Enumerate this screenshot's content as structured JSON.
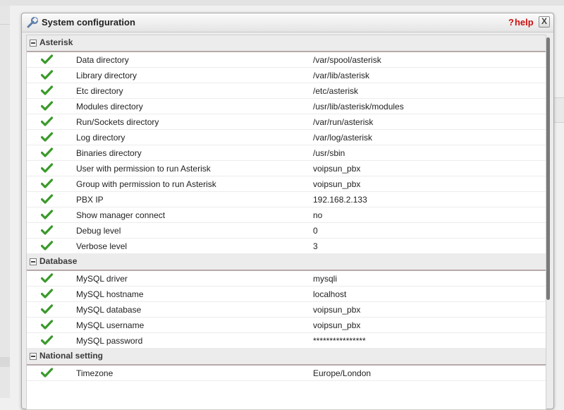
{
  "dialog": {
    "title": "System configuration",
    "help_mark": "?",
    "help_label": "help",
    "close_label": "X"
  },
  "sections": {
    "asterisk": {
      "title": "Asterisk",
      "rows": [
        {
          "label": "Data directory",
          "value": "/var/spool/asterisk"
        },
        {
          "label": "Library directory",
          "value": "/var/lib/asterisk"
        },
        {
          "label": "Etc directory",
          "value": "/etc/asterisk"
        },
        {
          "label": "Modules directory",
          "value": "/usr/lib/asterisk/modules"
        },
        {
          "label": "Run/Sockets directory",
          "value": "/var/run/asterisk"
        },
        {
          "label": "Log directory",
          "value": "/var/log/asterisk"
        },
        {
          "label": "Binaries directory",
          "value": "/usr/sbin"
        },
        {
          "label": "User with permission to run Asterisk",
          "value": "voipsun_pbx"
        },
        {
          "label": "Group with permission to run Asterisk",
          "value": "voipsun_pbx"
        },
        {
          "label": "PBX IP",
          "value": "192.168.2.133"
        },
        {
          "label": "Show manager connect",
          "value": "no"
        },
        {
          "label": "Debug level",
          "value": "0"
        },
        {
          "label": "Verbose level",
          "value": "3"
        }
      ]
    },
    "database": {
      "title": "Database",
      "rows": [
        {
          "label": "MySQL driver",
          "value": "mysqli"
        },
        {
          "label": "MySQL hostname",
          "value": "localhost"
        },
        {
          "label": "MySQL database",
          "value": "voipsun_pbx"
        },
        {
          "label": "MySQL username",
          "value": "voipsun_pbx"
        },
        {
          "label": "MySQL password",
          "value": "****************"
        }
      ]
    },
    "national": {
      "title": "National setting",
      "rows": [
        {
          "label": "Timezone",
          "value": "Europe/London"
        }
      ]
    }
  },
  "icons": {
    "row_status": "check-icon",
    "title": "wrench-icon",
    "check_color": "#3a9a2a"
  }
}
